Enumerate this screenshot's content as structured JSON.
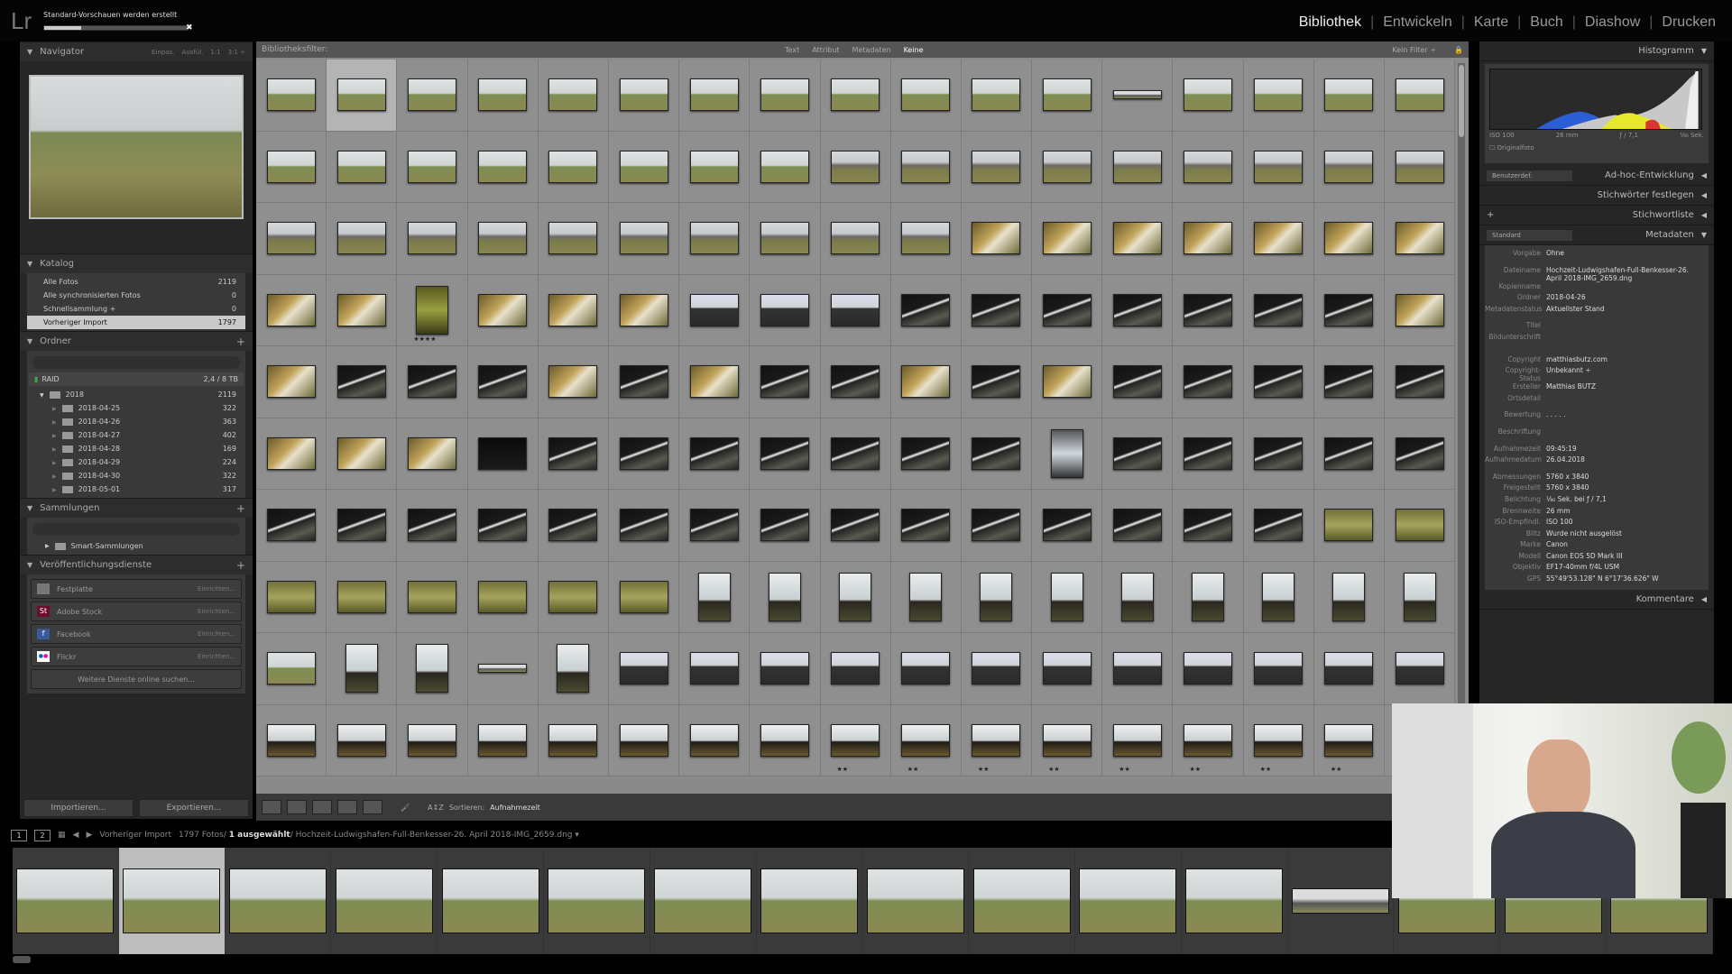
{
  "app": {
    "logo": "Lr",
    "progress_label": "Standard-Vorschauen werden erstellt",
    "progress_fraction": 0.26
  },
  "modules": [
    {
      "label": "Bibliothek",
      "active": true
    },
    {
      "label": "Entwickeln"
    },
    {
      "label": "Karte"
    },
    {
      "label": "Buch"
    },
    {
      "label": "Diashow"
    },
    {
      "label": "Drucken"
    }
  ],
  "navigator": {
    "title": "Navigator",
    "options": [
      "Einpas.",
      "Ausfül.",
      "1:1",
      "3:1 ÷"
    ]
  },
  "katalog": {
    "title": "Katalog",
    "items": [
      {
        "label": "Alle Fotos",
        "count": "2119"
      },
      {
        "label": "Alle synchronisierten Fotos",
        "count": "0"
      },
      {
        "label": "Schnellsammlung +",
        "count": "0"
      },
      {
        "label": "Vorheriger Import",
        "count": "1797",
        "selected": true
      }
    ]
  },
  "ordner": {
    "title": "Ordner",
    "volume": "RAID",
    "volume_info": "2,4 / 8 TB",
    "root": {
      "label": "2018",
      "count": "2119"
    },
    "folders": [
      {
        "label": "2018-04-25",
        "count": "322"
      },
      {
        "label": "2018-04-26",
        "count": "363"
      },
      {
        "label": "2018-04-27",
        "count": "402"
      },
      {
        "label": "2018-04-28",
        "count": "169"
      },
      {
        "label": "2018-04-29",
        "count": "224"
      },
      {
        "label": "2018-04-30",
        "count": "322"
      },
      {
        "label": "2018-05-01",
        "count": "317"
      }
    ]
  },
  "sammlungen": {
    "title": "Sammlungen",
    "items": [
      "Smart-Sammlungen"
    ]
  },
  "publish": {
    "title": "Veröffentlichungsdienste",
    "services": [
      {
        "label": "Festplatte",
        "action": "Einrichten..."
      },
      {
        "label": "Adobe Stock",
        "action": "Einrichten...",
        "icon": "St"
      },
      {
        "label": "Facebook",
        "action": "Einrichten...",
        "icon": "f"
      },
      {
        "label": "Flickr",
        "action": "Einrichten..."
      }
    ],
    "more": "Weitere Dienste online suchen..."
  },
  "left_buttons": {
    "import": "Importieren...",
    "export": "Exportieren..."
  },
  "filter": {
    "label": "Bibliotheksfilter:",
    "tabs": [
      "Text",
      "Attribut",
      "Metadaten",
      "Keine"
    ],
    "active": "Keine",
    "right": "Kein Filter ÷"
  },
  "grid": {
    "selected_index": 1,
    "rows": [
      "LLLLLLLLLLLLPLLLL",
      "LLLLLLLLMMMMMMMMM",
      "MMMMMMMMMMWWWWWWW",
      "WWwWWWSSSDDDDDDDW",
      "WDDDWDWDDWDWDDDDD",
      "WWWBDDDDDDDdDDDDD",
      "DDDDDDDDDDDDDDDGG",
      "GGGGGGrrrrrrrrrrr",
      "LrrPrSSSSSSSSSSSS",
      "KKKKKKKKKKKKKKKKx"
    ],
    "stars": {
      "3,2": "★★★★",
      "9,8": "★★",
      "9,9": "★★",
      "9,10": "★★",
      "9,11": "★★",
      "9,12": "★★",
      "9,13": "★★",
      "9,14": "★★",
      "9,15": "★★"
    }
  },
  "toolbar": {
    "sort_label": "Sortieren:",
    "sort_value": "Aufnahmezeit"
  },
  "right": {
    "histogram": "Histogramm",
    "hist_info": [
      "ISO 100",
      "26 mm",
      "ƒ / 7,1",
      "¹⁄₈₀ Sek."
    ],
    "original": "Originalfoto",
    "quick_dev": "Ad-hoc-Entwicklung",
    "quick_dev_preset": "Benutzerdef.",
    "keywording": "Stichwörter festlegen",
    "keyword_list": "Stichwortliste",
    "metadata": "Metadaten",
    "metadata_preset": "Standard",
    "meta_rows": [
      {
        "k": "Vorgabe",
        "v": "Ohne"
      },
      {
        "gap": true
      },
      {
        "k": "Dateiname",
        "v": "Hochzeit-Ludwigshafen-Full-Benkesser-26. April 2018-IMG_2659.dng"
      },
      {
        "k": "Kopienname",
        "v": ""
      },
      {
        "k": "Ordner",
        "v": "2018-04-26"
      },
      {
        "k": "Metadatenstatus",
        "v": "Aktuellster Stand"
      },
      {
        "gap": true
      },
      {
        "k": "Titel",
        "v": ""
      },
      {
        "k": "Bildunterschrift",
        "v": ""
      },
      {
        "gap": true
      },
      {
        "gap": true
      },
      {
        "k": "Copyright",
        "v": "matthiasbutz.com"
      },
      {
        "k": "Copyright-Status",
        "v": "Unbekannt ÷"
      },
      {
        "k": "Ersteller",
        "v": "Matthias BUTZ"
      },
      {
        "k": "Ortsdetail",
        "v": ""
      },
      {
        "gap": true
      },
      {
        "k": "Bewertung",
        "v": ". . . . ."
      },
      {
        "gap": true
      },
      {
        "k": "Beschriftung",
        "v": ""
      },
      {
        "gap": true
      },
      {
        "k": "Aufnahmezeit",
        "v": "09:45:19"
      },
      {
        "k": "Aufnahmedatum",
        "v": "26.04.2018"
      },
      {
        "gap": true
      },
      {
        "k": "Abmessungen",
        "v": "5760 x 3840"
      },
      {
        "k": "Freigestellt",
        "v": "5760 x 3840"
      },
      {
        "k": "Belichtung",
        "v": "¹⁄₈₀ Sek. bei ƒ / 7,1"
      },
      {
        "k": "Brennweite",
        "v": "26 mm"
      },
      {
        "k": "ISO-Empfindl.",
        "v": "ISO 100"
      },
      {
        "k": "Blitz",
        "v": "Wurde nicht ausgelöst"
      },
      {
        "k": "Marke",
        "v": "Canon"
      },
      {
        "k": "Modell",
        "v": "Canon EOS 5D Mark III"
      },
      {
        "k": "Objektiv",
        "v": "EF17-40mm f/4L USM"
      },
      {
        "k": "GPS",
        "v": "55°49'53.128\" N 6°17'36.626\" W"
      }
    ],
    "comments": "Kommentare"
  },
  "filmstrip": {
    "screens": [
      "1",
      "2"
    ],
    "source": "Vorheriger Import",
    "count": "1797 Fotos/",
    "selected": "1 ausgewählt",
    "file": "/ Hochzeit-Ludwigshafen-Full-Benkesser-26. April 2018-IMG_2659.dng ▾",
    "selected_index": 1,
    "items": "LLLLLLLLLLLLPLLL"
  }
}
